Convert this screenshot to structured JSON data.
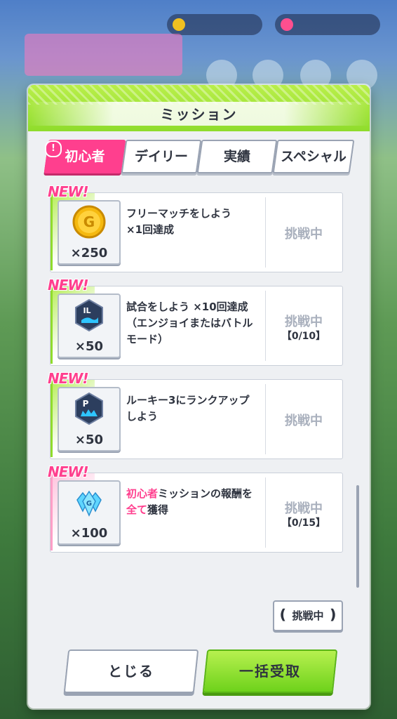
{
  "panel": {
    "title": "ミッション"
  },
  "tabs": [
    {
      "label": "初心者",
      "active": true
    },
    {
      "label": "デイリー",
      "active": false
    },
    {
      "label": "実績",
      "active": false
    },
    {
      "label": "スペシャル",
      "active": false
    }
  ],
  "tab_alert": "!",
  "missions": [
    {
      "new_label": "NEW!",
      "reward_icon": "gold-coin-icon",
      "reward_qty": "×250",
      "line1": "フリーマッチをしよう",
      "line2": "×1回達成",
      "line3": "",
      "status": "挑戦中",
      "progress": ""
    },
    {
      "new_label": "NEW!",
      "reward_icon": "il-hexagon-item-icon",
      "reward_qty": "×50",
      "line1": "試合をしよう ×10回達成",
      "line2": "（エンジョイまたはバトル",
      "line3": "モード）",
      "status": "挑戦中",
      "progress": "【0/10】"
    },
    {
      "new_label": "NEW!",
      "reward_icon": "p-hexagon-item-icon",
      "reward_qty": "×50",
      "line1": "ルーキー3にランクアップ",
      "line2": "しよう",
      "line3": "",
      "status": "挑戦中",
      "progress": ""
    },
    {
      "new_label": "NEW!",
      "reward_icon": "blue-gem-icon",
      "reward_qty": "×100",
      "hl1": "初心者",
      "rest1": "ミッションの報酬を",
      "hl2": "全て",
      "rest2": "獲得",
      "status": "挑戦中",
      "progress": "【0/15】"
    }
  ],
  "filter_button": {
    "label": "挑戦中",
    "left_arrow": "❪",
    "right_arrow": "❫"
  },
  "buttons": {
    "close": "とじる",
    "claim_all": "一括受取"
  },
  "colors": {
    "accent_green": "#8fdc2c",
    "accent_pink": "#ff3f8e",
    "muted_status": "#a9b0bd"
  }
}
